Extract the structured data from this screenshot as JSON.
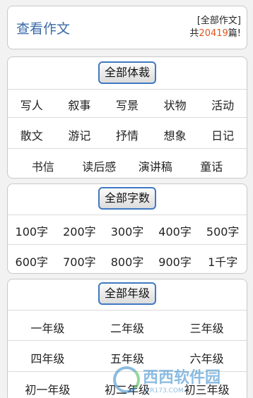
{
  "header": {
    "title": "查看作文",
    "scope_label": "[全部作文]",
    "count_prefix": "共",
    "count": "20419",
    "count_suffix": "篇!"
  },
  "genre": {
    "button": "全部体裁",
    "rows": [
      [
        "写人",
        "叙事",
        "写景",
        "状物",
        "活动"
      ],
      [
        "散文",
        "游记",
        "抒情",
        "想象",
        "日记"
      ],
      [
        "书信",
        "读后感",
        "演讲稿",
        "童话"
      ]
    ]
  },
  "words": {
    "button": "全部字数",
    "rows": [
      [
        "100字",
        "200字",
        "300字",
        "400字",
        "500字"
      ],
      [
        "600字",
        "700字",
        "800字",
        "900字",
        "1千字"
      ]
    ]
  },
  "grade": {
    "button": "全部年级",
    "rows": [
      [
        "一年级",
        "二年级",
        "三年级"
      ],
      [
        "四年级",
        "五年级",
        "六年级"
      ],
      [
        "初一年级",
        "初二年级",
        "初三年级"
      ]
    ]
  },
  "watermark": {
    "text": "西西软件园",
    "sub": "CR173.COM"
  },
  "colors": {
    "title_blue": "#3a6aa8",
    "count_orange": "#e0561b",
    "pill_border": "#3f79c2"
  }
}
